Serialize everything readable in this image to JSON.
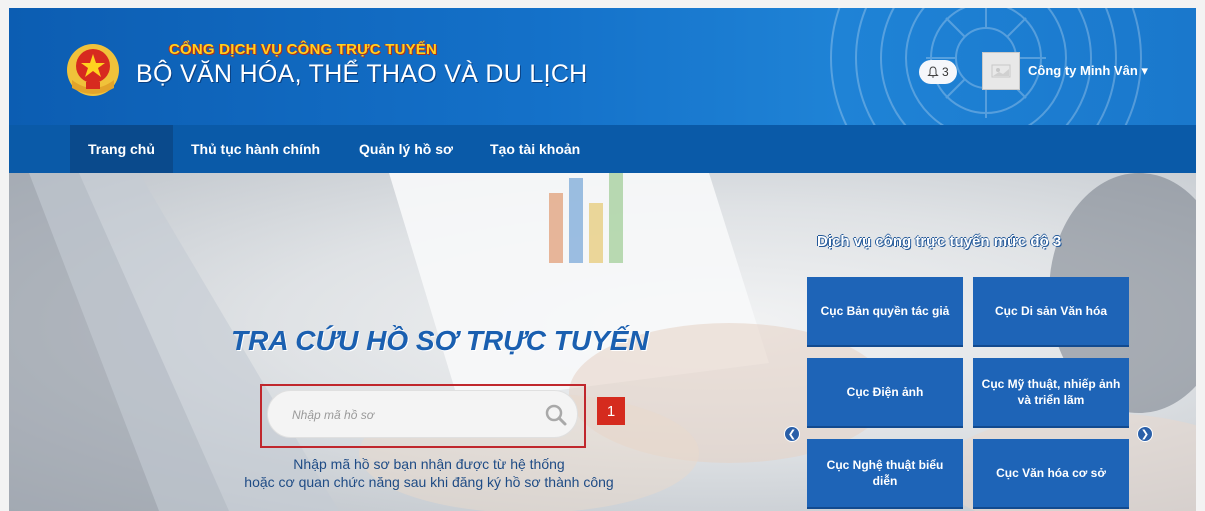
{
  "header": {
    "agency_line": "CỔNG DỊCH VỤ CÔNG TRỰC TUYẾN",
    "ministry": "BỘ VĂN HÓA, THỂ THAO VÀ DU LỊCH",
    "notification_count": "3",
    "user_name": "Công ty Minh Vân",
    "icons": [
      "national-emblem-icon",
      "bell-icon",
      "chevron-down-icon"
    ]
  },
  "nav": {
    "items": [
      {
        "label": "Trang chủ",
        "active": true
      },
      {
        "label": "Thủ tục hành chính"
      },
      {
        "label": "Quản lý hồ sơ"
      },
      {
        "label": "Tạo tài khoản"
      }
    ]
  },
  "hero": {
    "title": "TRA CỨU HỒ SƠ TRỰC TUYẾN",
    "search_placeholder": "Nhập mã hồ sơ",
    "callout_number": "1",
    "hint_line1": "Nhập mã hồ sơ bạn nhận được từ hệ thống",
    "hint_line2": "hoặc cơ quan chức năng sau khi đăng ký hồ sơ thành công"
  },
  "services": {
    "title": "Dịch vụ công trực tuyến mức độ 3",
    "tiles": [
      "Cục Bản quyền tác giả",
      "Cục Di sản Văn hóa",
      "Cục Điện ảnh",
      "Cục Mỹ thuật, nhiếp ảnh và triển lãm",
      "Cục Nghệ thuật biểu diễn",
      "Cục Văn hóa cơ sở"
    ],
    "prev_icon": "chevron-left-icon",
    "next_icon": "chevron-right-icon"
  },
  "colors": {
    "header_blue": "#1471c9",
    "nav_blue": "#0a5aa8",
    "tile_blue": "#1e64b7",
    "callout_red": "#d52b1e",
    "accent_yellow": "#ffd21f"
  }
}
